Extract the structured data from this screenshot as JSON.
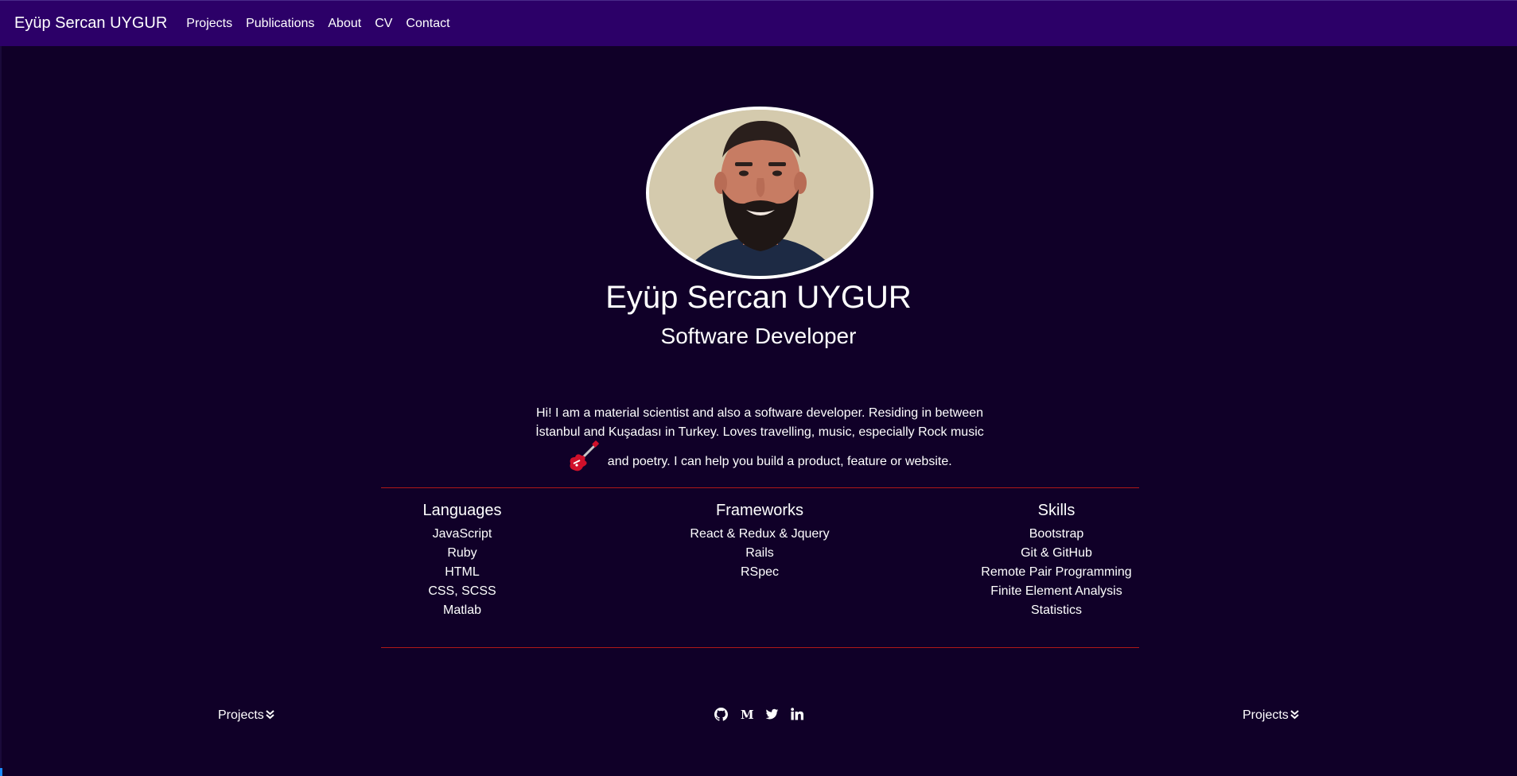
{
  "nav": {
    "brand": "Eyüp Sercan UYGUR",
    "links": [
      "Projects",
      "Publications",
      "About",
      "CV",
      "Contact"
    ]
  },
  "hero": {
    "name": "Eyüp Sercan UYGUR",
    "role": "Software Developer",
    "bio_line1": "Hi! I am a material scientist and also a software developer. Residing in between",
    "bio_line2": "İstanbul and Kuşadası in Turkey. Loves travelling, music, especially Rock music",
    "bio_line3": "and poetry. I can help you build a product, feature or website."
  },
  "columns": {
    "languages": {
      "title": "Languages",
      "items": [
        "JavaScript",
        "Ruby",
        "HTML",
        "CSS, SCSS",
        "Matlab"
      ]
    },
    "frameworks": {
      "title": "Frameworks",
      "items": [
        "React & Redux & Jquery",
        "Rails",
        "RSpec"
      ]
    },
    "skills": {
      "title": "Skills",
      "items": [
        "Bootstrap",
        "Git & GitHub",
        "Remote Pair Programming",
        "Finite Element Analysis",
        "Statistics"
      ]
    }
  },
  "footer": {
    "left_link": "Projects",
    "right_link": "Projects",
    "socials": [
      "github-icon",
      "medium-icon",
      "twitter-icon",
      "linkedin-icon"
    ]
  },
  "colors": {
    "navbar": "#2c0068",
    "background": "#100028",
    "divider": "#b01818",
    "text": "#ffffff"
  }
}
